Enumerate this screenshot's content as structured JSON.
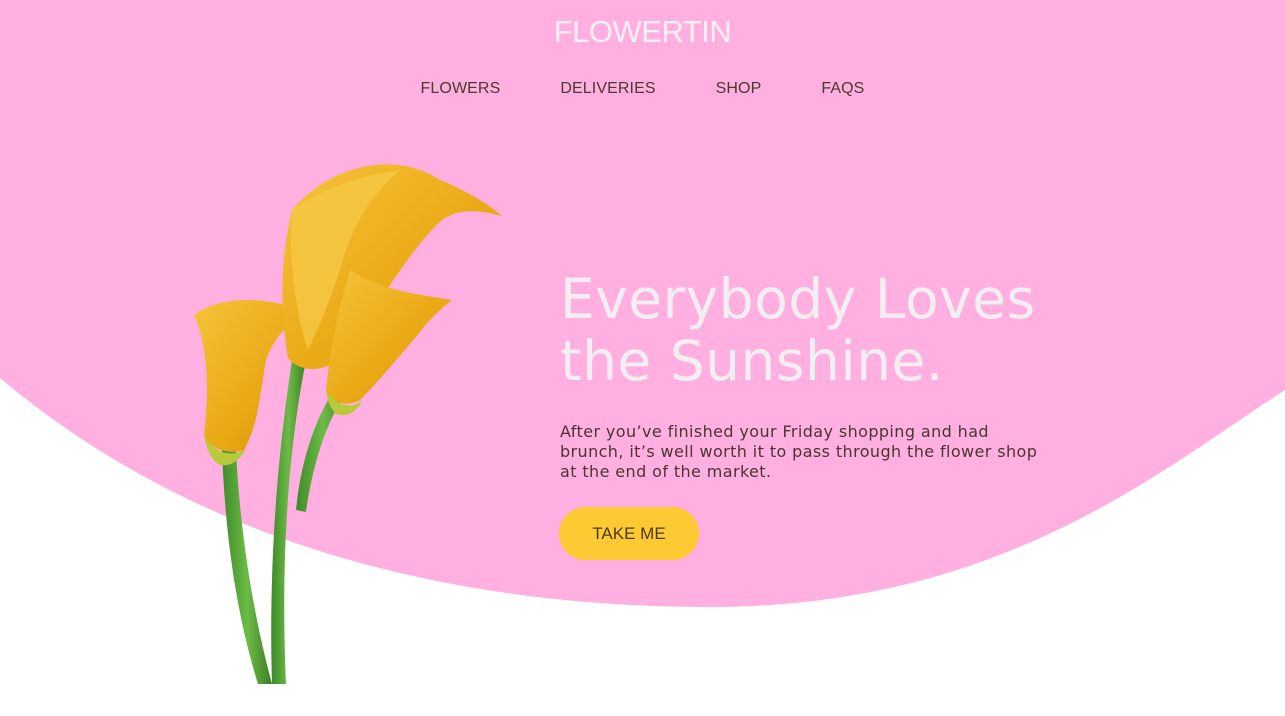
{
  "brand": {
    "name": "FLOWERTIN"
  },
  "nav": {
    "items": [
      {
        "label": "FLOWERS"
      },
      {
        "label": "DELIVERIES"
      },
      {
        "label": "SHOP"
      },
      {
        "label": "FAQS"
      }
    ]
  },
  "hero": {
    "headline": "Everybody Loves the Sunshine.",
    "body": "After you’ve finished your Friday shopping and had brunch, it’s well worth it to pass through the flower shop at the end of the market.",
    "cta_label": "TAKE ME",
    "image": "yellow-calla-lilies"
  },
  "colors": {
    "background_pink": "#ffb0e0",
    "page_white": "#ffffff",
    "cta_yellow": "#ffc933",
    "headline_text": "#f2eef1",
    "nav_text": "#4a3a2c"
  }
}
